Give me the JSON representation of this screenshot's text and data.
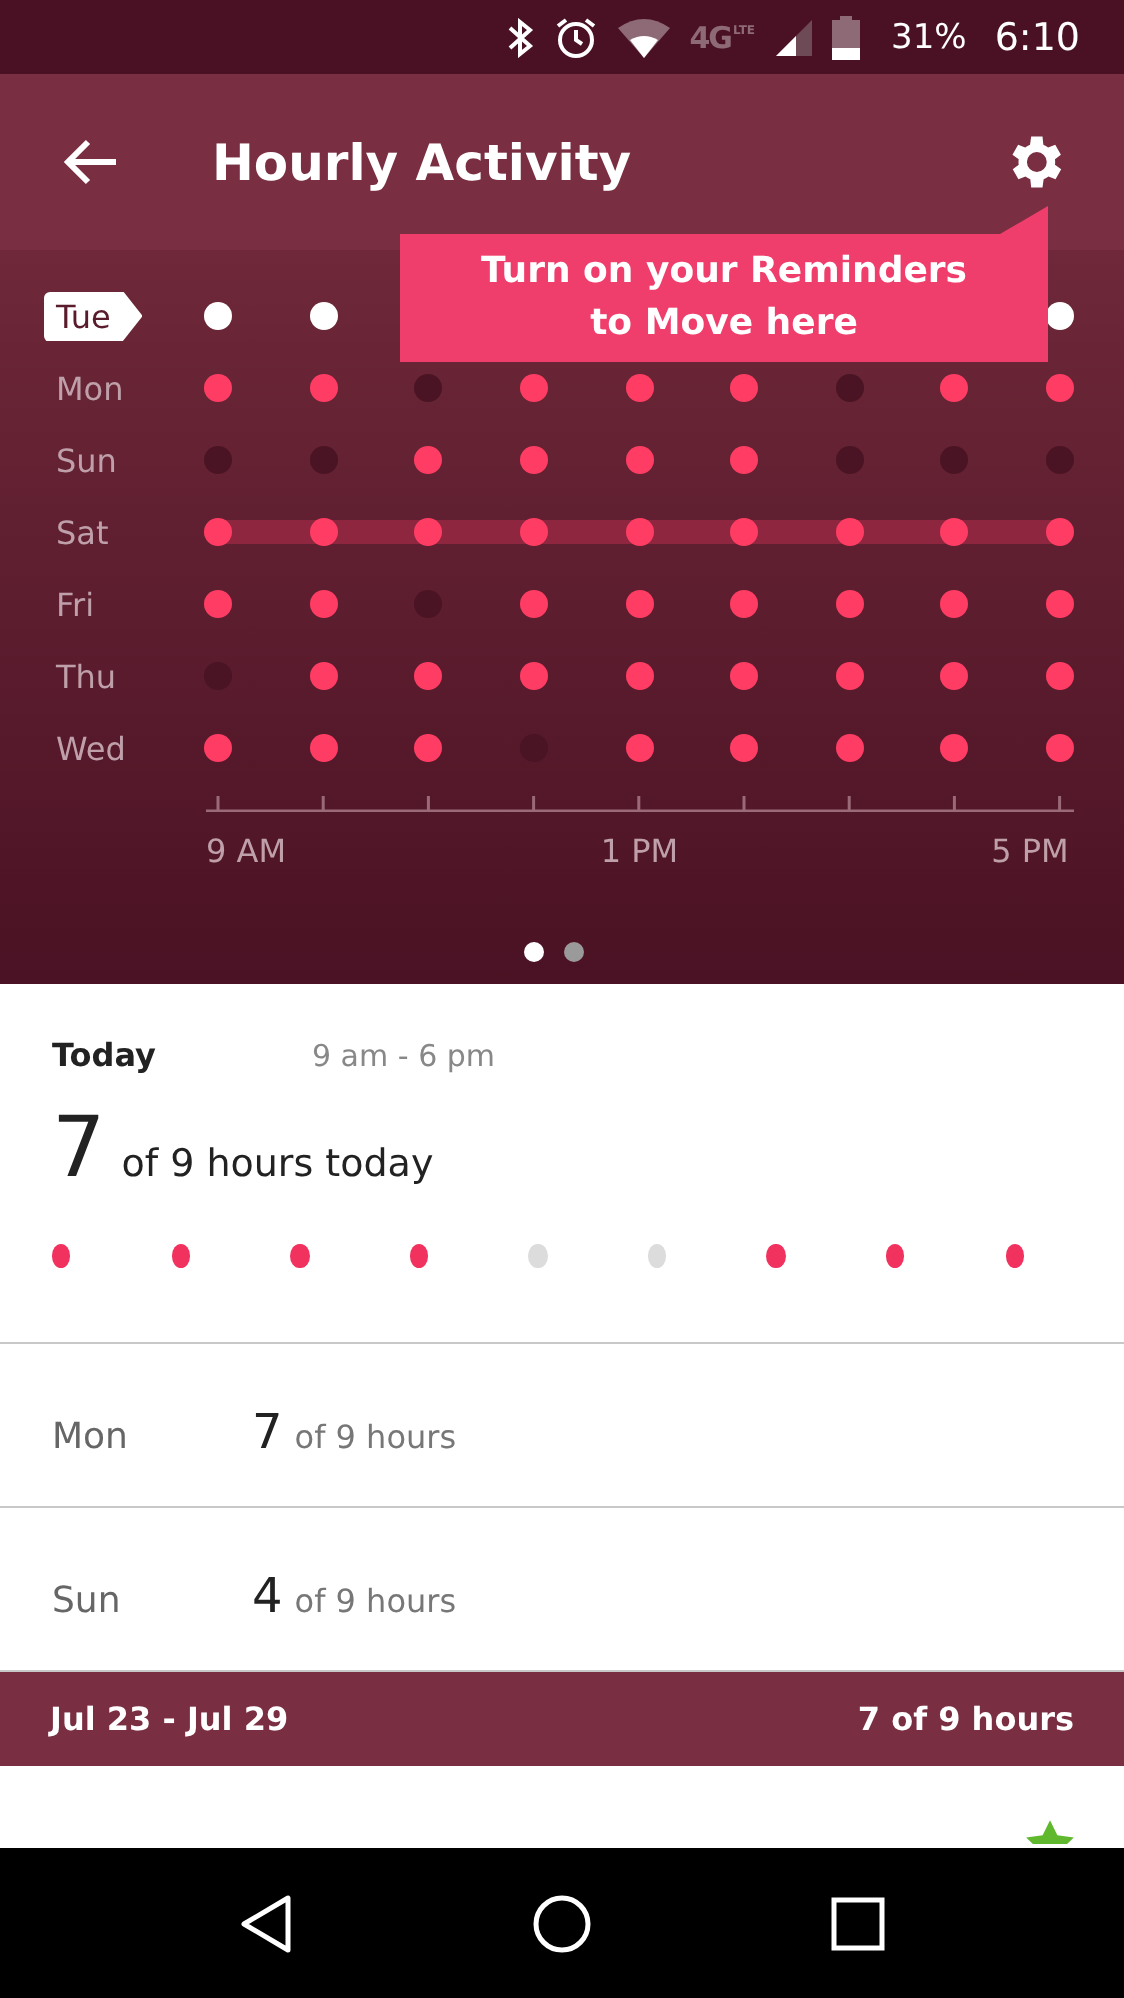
{
  "status_bar": {
    "network": "4G",
    "network_sub": "LTE",
    "battery_percent": "31%",
    "time": "6:10"
  },
  "app_bar": {
    "title": "Hourly Activity"
  },
  "tooltip": {
    "text": "Turn on your Reminders to Move here"
  },
  "grid": {
    "days": [
      {
        "label": "Tue",
        "selected": true,
        "highlighted": false,
        "under_tooltip": true,
        "hours": [
          true,
          true,
          true
        ]
      },
      {
        "label": "Mon",
        "selected": false,
        "highlighted": false,
        "hours": [
          true,
          true,
          false,
          true,
          true,
          true,
          false,
          true,
          true
        ]
      },
      {
        "label": "Sun",
        "selected": false,
        "highlighted": false,
        "hours": [
          false,
          false,
          true,
          true,
          true,
          true,
          false,
          false,
          false
        ]
      },
      {
        "label": "Sat",
        "selected": false,
        "highlighted": true,
        "hours": [
          true,
          true,
          true,
          true,
          true,
          true,
          true,
          true,
          true
        ]
      },
      {
        "label": "Fri",
        "selected": false,
        "highlighted": false,
        "hours": [
          true,
          true,
          false,
          true,
          true,
          true,
          true,
          true,
          true
        ]
      },
      {
        "label": "Thu",
        "selected": false,
        "highlighted": false,
        "hours": [
          false,
          true,
          true,
          true,
          true,
          true,
          true,
          true,
          true
        ]
      },
      {
        "label": "Wed",
        "selected": false,
        "highlighted": false,
        "hours": [
          true,
          true,
          true,
          false,
          true,
          true,
          true,
          true,
          true
        ]
      }
    ],
    "axis_labels": [
      "9 AM",
      "1 PM",
      "5 PM"
    ]
  },
  "pages": [
    {
      "selected": true
    },
    {
      "selected": false
    }
  ],
  "today": {
    "title": "Today",
    "range": "9 am - 6 pm",
    "count": "7",
    "summary": "of 9 hours today",
    "hours": [
      true,
      true,
      true,
      true,
      false,
      false,
      true,
      true,
      true
    ]
  },
  "days": [
    {
      "day": "Mon",
      "count": "7",
      "summary": "of 9 hours"
    },
    {
      "day": "Sun",
      "count": "4",
      "summary": "of 9 hours"
    }
  ],
  "week_header": {
    "range": "Jul 23 - Jul 29",
    "summary": "7 of 9 hours"
  },
  "partial_row": {
    "starred": true
  }
}
